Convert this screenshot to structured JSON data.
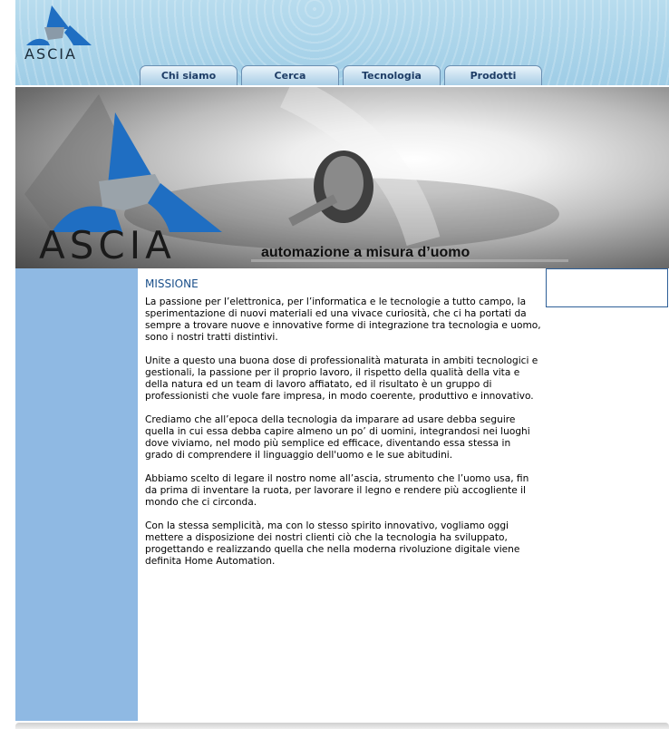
{
  "brand": {
    "logo_text": "ASCIA",
    "tagline": "automazione a misura d’uomo"
  },
  "nav": {
    "tabs": [
      {
        "label": "Chi siamo"
      },
      {
        "label": "Cerca"
      },
      {
        "label": "Tecnologia"
      },
      {
        "label": "Prodotti"
      }
    ]
  },
  "content": {
    "title": "MISSIONE",
    "paragraphs": [
      "La passione per l’elettronica, per l’informatica e le tecnologie a tutto campo, la sperimentazione di nuovi materiali ed una vivace curiosità, che ci ha portati da sempre a trovare nuove e innovative forme di integrazione tra tecnologia e uomo, sono i nostri tratti distintivi.",
      "Unite a questo una buona dose di professionalità maturata in ambiti tecnologici e gestionali, la passione per il proprio lavoro, il rispetto della qualità della vita e della natura ed un team di lavoro affiatato, ed il risultato è un gruppo di professionisti che vuole fare impresa, in modo coerente, produttivo e innovativo.",
      "Crediamo che all’epoca della tecnologia da imparare ad usare debba seguire quella in cui essa debba capire almeno un po’ di uomini, integrandosi nei luoghi dove viviamo, nel modo più semplice ed efficace, diventando essa stessa in grado di comprendere il linguaggio dell'uomo e le sue abitudini.",
      "Abbiamo scelto di legare il nostro nome all’ascia, strumento che l’uomo usa, fin da prima di inventare la ruota, per lavorare il legno e rendere più accogliente il mondo che ci circonda.",
      "Con la stessa semplicità, ma con lo stesso spirito innovativo, vogliamo oggi mettere a disposizione dei nostri clienti ciò che la tecnologia ha sviluppato, progettando e realizzando quella che nella moderna rivoluzione digitale viene definita Home Automation."
    ]
  },
  "colors": {
    "header_bg": "#a8d4ea",
    "left_column": "#8fb9e3",
    "title": "#1a4f8a",
    "tab_text": "#1e3d66",
    "logo_blue": "#1f6ec2"
  }
}
